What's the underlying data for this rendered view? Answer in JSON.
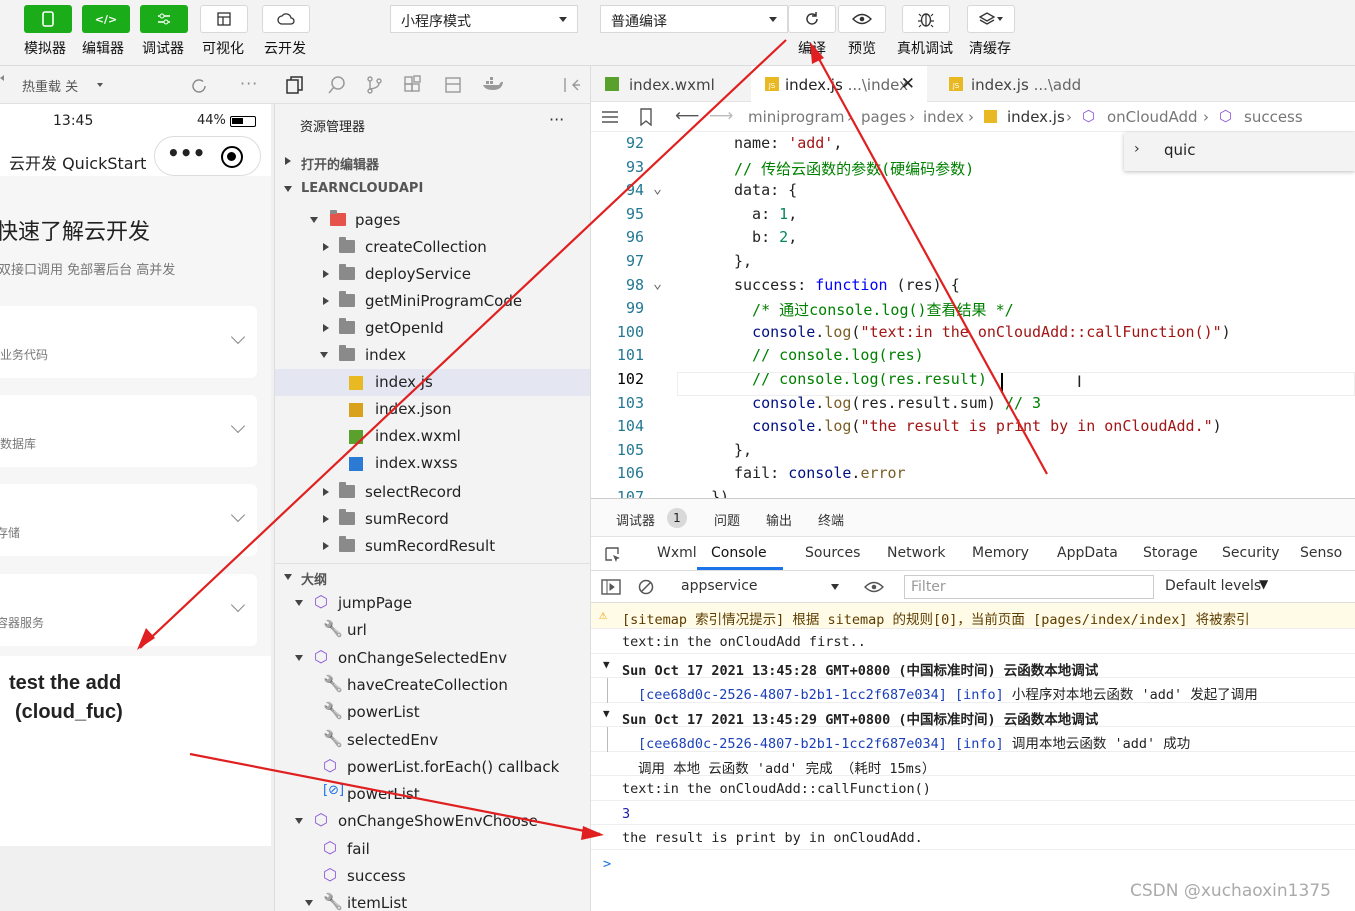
{
  "toolbar": {
    "buttons": [
      {
        "label": "模拟器",
        "icon": "phone-icon"
      },
      {
        "label": "编辑器",
        "icon": "code-icon"
      },
      {
        "label": "调试器",
        "icon": "sliders-icon"
      },
      {
        "label": "可视化",
        "icon": "layout-icon"
      },
      {
        "label": "云开发",
        "icon": "cloud-icon"
      }
    ],
    "mode_select": "小程序模式",
    "compile_select": "普通编译",
    "actions": [
      {
        "label": "编译",
        "icon": "refresh-icon"
      },
      {
        "label": "预览",
        "icon": "eye-icon"
      },
      {
        "label": "真机调试",
        "icon": "bug-icon"
      },
      {
        "label": "清缓存",
        "icon": "layers-icon"
      }
    ]
  },
  "simulator": {
    "hot_reload": "热重载 关",
    "time": "13:45",
    "battery": "44%",
    "app_title": "云开发 QuickStart",
    "heading": "快速了解云开发",
    "subtitle": "双接口调用 免部署后台 高并发",
    "cards": [
      "业务代码",
      "数据库",
      "存储",
      "容器服务"
    ],
    "annotation_line1": "test the add",
    "annotation_line2": "(cloud_fuc)"
  },
  "explorer": {
    "title": "资源管理器",
    "more": "···",
    "open_editors": "打开的编辑器",
    "project": "LEARNCLOUDAPI",
    "pages": "pages",
    "folders_top": [
      "createCollection",
      "deployService",
      "getMiniProgramCode",
      "getOpenId"
    ],
    "index_folder": "index",
    "files": [
      {
        "name": "index.js",
        "icon": "js-file-icon"
      },
      {
        "name": "index.json",
        "icon": "json-file-icon"
      },
      {
        "name": "index.wxml",
        "icon": "wxml-file-icon"
      },
      {
        "name": "index.wxss",
        "icon": "css-file-icon"
      }
    ],
    "folders_bottom": [
      "selectRecord",
      "sumRecord",
      "sumRecordResult"
    ],
    "outline_title": "大纲",
    "outline": [
      {
        "label": "jumpPage",
        "kind": "cube",
        "depth": 0,
        "open": true
      },
      {
        "label": "url",
        "kind": "wrench",
        "depth": 1
      },
      {
        "label": "onChangeSelectedEnv",
        "kind": "cube",
        "depth": 0,
        "open": true
      },
      {
        "label": "haveCreateCollection",
        "kind": "wrench",
        "depth": 1
      },
      {
        "label": "powerList",
        "kind": "wrench",
        "depth": 1
      },
      {
        "label": "selectedEnv",
        "kind": "wrench",
        "depth": 1
      },
      {
        "label": "powerList.forEach() callback",
        "kind": "cube",
        "depth": 1
      },
      {
        "label": "powerList",
        "kind": "var",
        "depth": 1
      },
      {
        "label": "onChangeShowEnvChoose",
        "kind": "cube",
        "depth": 0,
        "open": true
      },
      {
        "label": "fail",
        "kind": "cube",
        "depth": 1
      },
      {
        "label": "success",
        "kind": "cube",
        "depth": 1
      },
      {
        "label": "itemList",
        "kind": "wrench",
        "depth": 1,
        "open": true
      }
    ]
  },
  "editor": {
    "tabs": [
      {
        "label": "index.wxml",
        "active": false
      },
      {
        "label": "index.js",
        "path": "...\\index",
        "active": true
      },
      {
        "label": "index.js",
        "path": "...\\add",
        "active": false
      }
    ],
    "breadcrumb": [
      "miniprogram",
      "pages",
      "index",
      "index.js",
      "onCloudAdd",
      "success"
    ],
    "find_value": "quic",
    "current_line": "102",
    "lines": [
      {
        "n": "92",
        "code": "name: 'add',"
      },
      {
        "n": "93",
        "code": "// 传给云函数的参数(硬编码参数)"
      },
      {
        "n": "94",
        "code": "data: {"
      },
      {
        "n": "95",
        "code": "  a: 1,"
      },
      {
        "n": "96",
        "code": "  b: 2,"
      },
      {
        "n": "97",
        "code": "},"
      },
      {
        "n": "98",
        "code": "success: function (res) {"
      },
      {
        "n": "99",
        "code": "  /* 通过console.log()查看结果 */"
      },
      {
        "n": "100",
        "code": "  console.log(\"text:in the onCloudAdd::callFunction()\")"
      },
      {
        "n": "101",
        "code": "  // console.log(res)"
      },
      {
        "n": "102",
        "code": "  // console.log(res.result)"
      },
      {
        "n": "103",
        "code": "  console.log(res.result.sum) // 3"
      },
      {
        "n": "104",
        "code": "  console.log(\"the result is print by in onCloudAdd.\")"
      },
      {
        "n": "105",
        "code": "},"
      },
      {
        "n": "106",
        "code": "fail: console.error"
      },
      {
        "n": "107",
        "code": "})"
      }
    ]
  },
  "devtools": {
    "top_tabs": [
      "调试器",
      "问题",
      "输出",
      "终端"
    ],
    "badge": "1",
    "panels": [
      "Wxml",
      "Console",
      "Sources",
      "Network",
      "Memory",
      "AppData",
      "Storage",
      "Security",
      "Senso"
    ],
    "active_panel": "Console",
    "context": "appservice",
    "filter_placeholder": "Filter",
    "levels": "Default levels",
    "console": [
      {
        "type": "warn",
        "text": "[sitemap 索引情况提示] 根据 sitemap 的规则[0]，当前页面 [pages/index/index] 将被索引"
      },
      {
        "type": "log",
        "text": "text:in the onCloudAdd first.."
      },
      {
        "type": "group",
        "text": "Sun Oct 17 2021 13:45:28 GMT+0800 (中国标准时间) 云函数本地调试"
      },
      {
        "type": "info",
        "text": "[cee68d0c-2526-4807-b2b1-1cc2f687e034] [info] 小程序对本地云函数 'add' 发起了调用"
      },
      {
        "type": "group",
        "text": "Sun Oct 17 2021 13:45:29 GMT+0800 (中国标准时间) 云函数本地调试"
      },
      {
        "type": "info",
        "text": "[cee68d0c-2526-4807-b2b1-1cc2f687e034] [info] 调用本地云函数 'add' 成功"
      },
      {
        "type": "sub",
        "text": "调用 本地 云函数 'add' 完成  （耗时 15ms）"
      },
      {
        "type": "log",
        "text": "text:in the onCloudAdd::callFunction()"
      },
      {
        "type": "num",
        "text": "3"
      },
      {
        "type": "log",
        "text": "the result is print by in onCloudAdd."
      }
    ],
    "prompt": ">"
  },
  "watermark": "CSDN @xuchaoxin1375",
  "colors": {
    "green": "#1aad19",
    "arrow": "#e02020",
    "accent": "#1a73e8"
  }
}
